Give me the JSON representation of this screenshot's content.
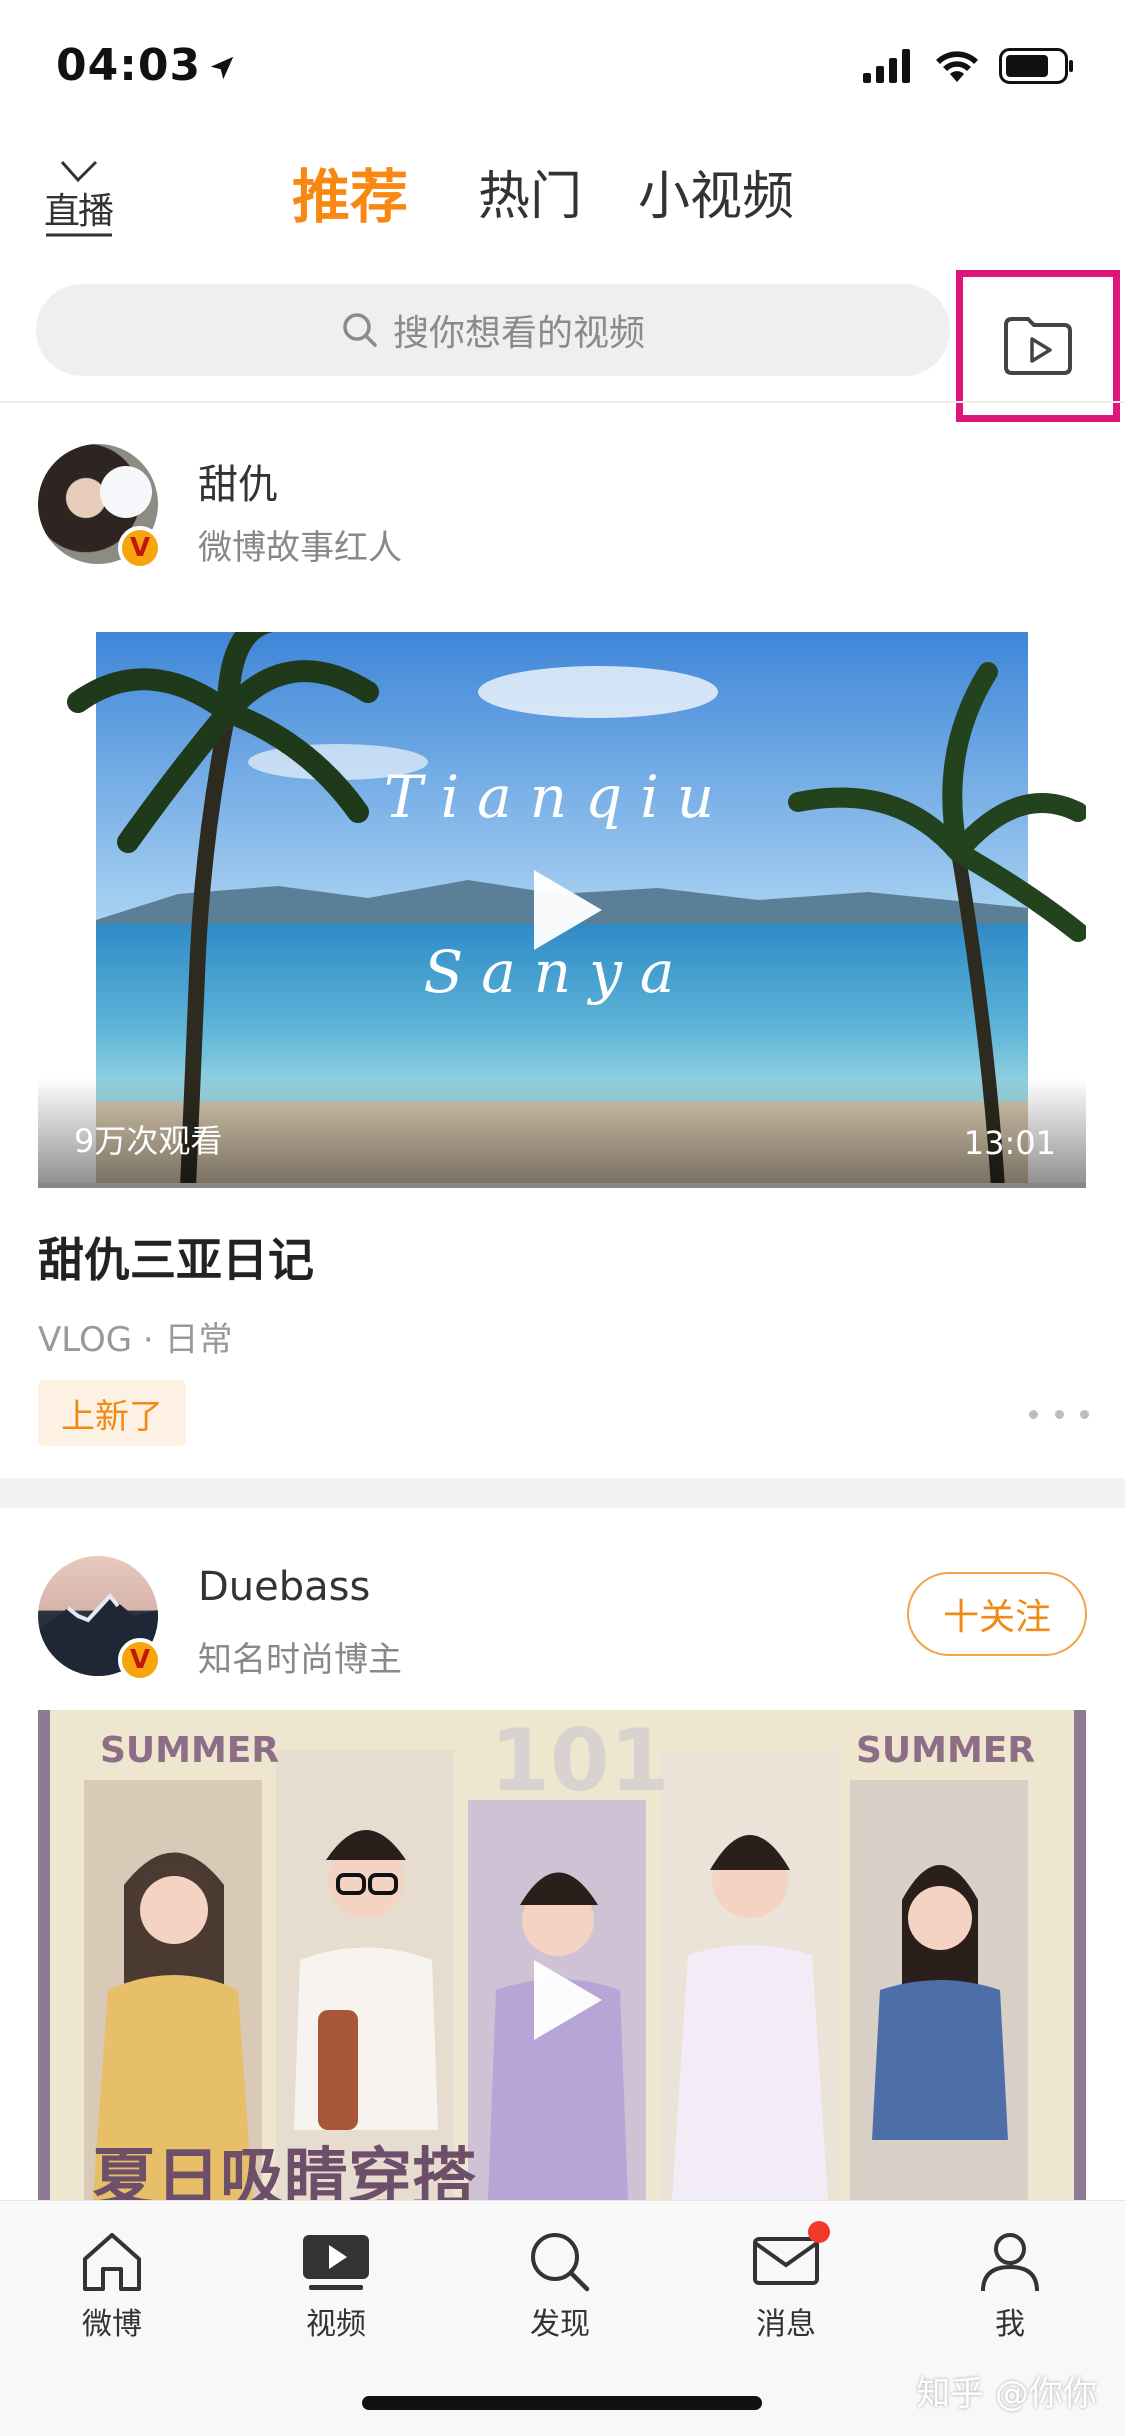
{
  "status": {
    "time": "04:03"
  },
  "nav": {
    "live_label": "直播",
    "tabs": [
      {
        "label": "推荐",
        "active": true
      },
      {
        "label": "热门",
        "active": false
      },
      {
        "label": "小视频",
        "active": false
      }
    ]
  },
  "search": {
    "placeholder": "搜你想看的视频"
  },
  "posts": [
    {
      "author": "甜仇",
      "desc": "微博故事红人",
      "verified_badge": "V",
      "thumb_text_1": "Tianqiu",
      "thumb_text_2": "Sanya",
      "views": "9万次观看",
      "duration": "13:01",
      "title": "甜仇三亚日记",
      "tags": "VLOG · 日常",
      "badge": "上新了"
    },
    {
      "author": "Duebass",
      "desc": "知名时尚博主",
      "verified_badge": "V",
      "follow_label": "十关注",
      "thumb_left_text": "SUMMER",
      "thumb_mid_text": "101",
      "thumb_right_text": "SUMMER",
      "thumb_bottom_text": "夏日吸睛穿搭"
    }
  ],
  "tabbar": [
    {
      "label": "微博",
      "icon": "home-icon"
    },
    {
      "label": "视频",
      "icon": "video-icon"
    },
    {
      "label": "发现",
      "icon": "search-icon"
    },
    {
      "label": "消息",
      "icon": "mail-icon"
    },
    {
      "label": "我",
      "icon": "person-icon"
    }
  ],
  "watermark": "知乎 @你你",
  "colors": {
    "accent": "#f98812",
    "highlight_box": "#e0157a",
    "badge_bg": "#fdf1e3",
    "notif_dot": "#f23a2a"
  }
}
